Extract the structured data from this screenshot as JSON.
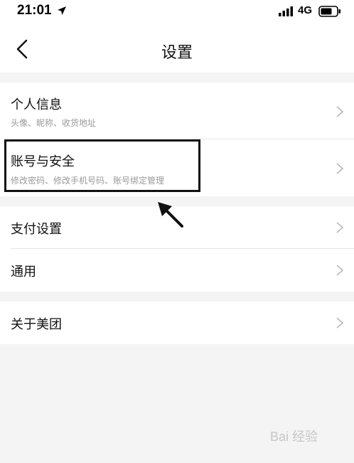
{
  "status_bar": {
    "time": "21:01",
    "network": "4G"
  },
  "nav": {
    "title": "设置",
    "back_icon": "chevron-left-icon"
  },
  "menu": {
    "personal_info": {
      "title": "个人信息",
      "subtitle": "头像、昵称、收货地址"
    },
    "account_security": {
      "title": "账号与安全",
      "subtitle": "修改密码、修改手机号码、账号绑定管理"
    },
    "payment_settings": {
      "title": "支付设置"
    },
    "general": {
      "title": "通用"
    },
    "about": {
      "title": "关于美团"
    }
  },
  "watermark": {
    "text": "Bai 经验"
  },
  "colors": {
    "background": "#f4f4f4",
    "card": "#ffffff",
    "divider": "#e6e6e6",
    "subtitle": "#9a9a9a",
    "chevron": "#b8b8b8"
  }
}
